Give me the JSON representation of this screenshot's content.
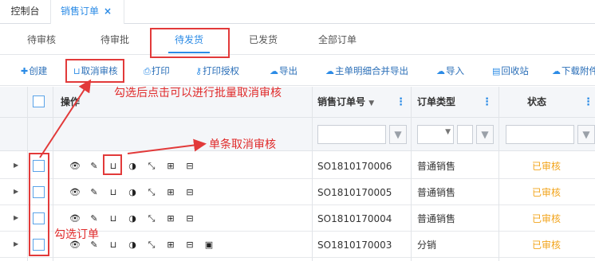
{
  "page_tabs": {
    "console": "控制台",
    "orders": "销售订单",
    "orders_close": "×"
  },
  "status_tabs": [
    "待审核",
    "待审批",
    "待发货",
    "已发货",
    "全部订单"
  ],
  "active_status_tab": "待发货",
  "toolbar": {
    "create": "创建",
    "unapprove": "取消审核",
    "print": "打印",
    "print_auth": "打印授权",
    "export": "导出",
    "export_detail": "主单明细合并导出",
    "import": "导入",
    "recycle": "回收站",
    "download_attach": "下载附件"
  },
  "table": {
    "headers": {
      "ops": "操作",
      "order_no": "销售订单号",
      "order_no_sort": "▼",
      "order_type": "订单类型",
      "status": "状态"
    },
    "rows": [
      {
        "order_no": "SO1810170006",
        "order_type": "普通销售",
        "status": "已审核"
      },
      {
        "order_no": "SO1810170005",
        "order_type": "普通销售",
        "status": "已审核"
      },
      {
        "order_no": "SO1810170004",
        "order_type": "普通销售",
        "status": "已审核"
      },
      {
        "order_no": "SO1810170003",
        "order_type": "分销",
        "status": "已审核"
      }
    ]
  },
  "annotations": {
    "batch": "勾选后点击可以进行批量取消审核",
    "single": "单条取消审核",
    "select": "勾选订单"
  },
  "colors": {
    "accent": "#2b8be6",
    "status_approved": "#f2a41b",
    "annotation": "#e02b2b"
  }
}
